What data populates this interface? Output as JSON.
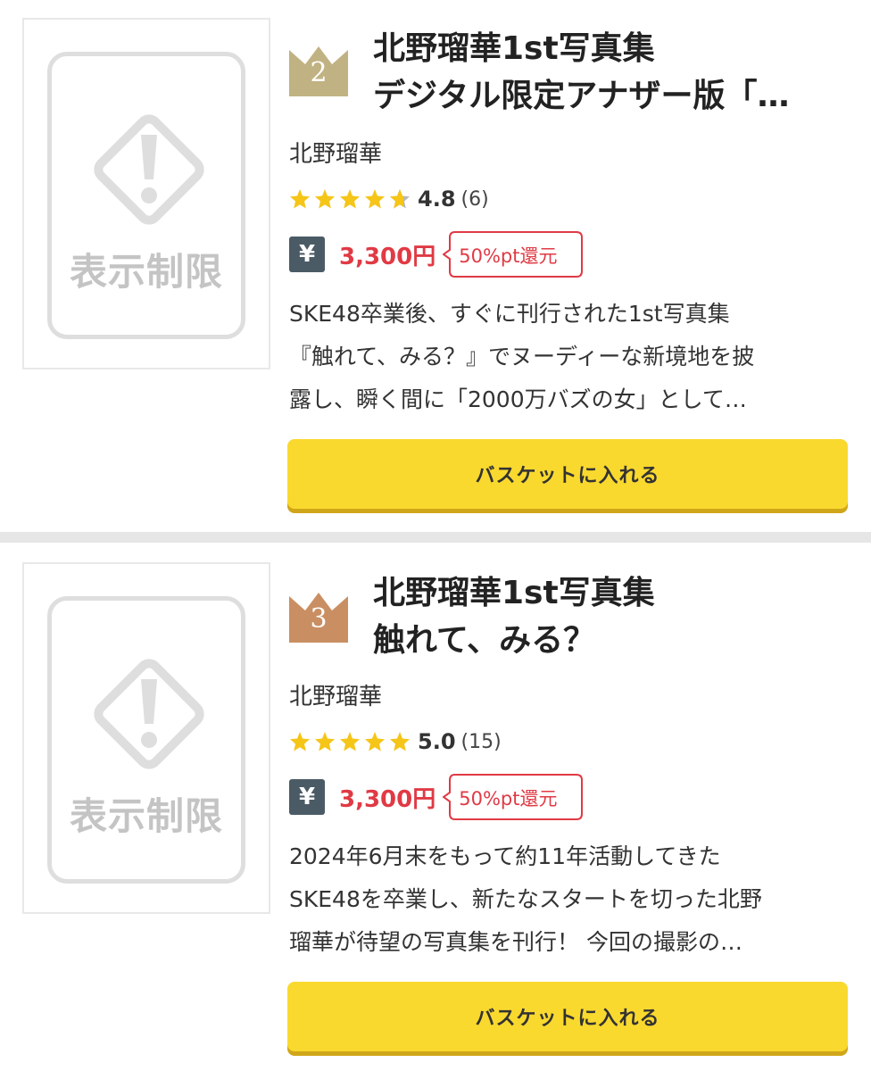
{
  "colors": {
    "accent_yellow": "#fad92e",
    "price_red": "#e03a45",
    "star": "#f5c518",
    "rank_2": "#c1b283",
    "rank_3": "#c98f63",
    "yen_badge": "#4b5b66"
  },
  "products": [
    {
      "rank": "2",
      "thumbnail_label": "表示制限",
      "title_lines": [
        "北野瑠華1st写真集",
        "デジタル限定アナザー版「…"
      ],
      "author": "北野瑠華",
      "rating_score": "4.8",
      "rating_count": "(6)",
      "stars_value": 4.8,
      "yen_icon": "¥",
      "price": "3,300円",
      "point_badge": "50%pt還元",
      "description_lines": [
        "SKE48卒業後、すぐに刊行された1st写真集",
        "『触れて、みる？』でヌーディーな新境地を披",
        "露し、瞬く間に「2000万バズの女」として…"
      ],
      "basket_label": "バスケットに入れる"
    },
    {
      "rank": "3",
      "thumbnail_label": "表示制限",
      "title_lines": [
        "北野瑠華1st写真集",
        "触れて、みる？"
      ],
      "author": "北野瑠華",
      "rating_score": "5.0",
      "rating_count": "(15)",
      "stars_value": 5.0,
      "yen_icon": "¥",
      "price": "3,300円",
      "point_badge": "50%pt還元",
      "description_lines": [
        "2024年6月末をもって約11年活動してきた",
        "SKE48を卒業し、新たなスタートを切った北野",
        "瑠華が待望の写真集を刊行！ 今回の撮影の…"
      ],
      "basket_label": "バスケットに入れる"
    }
  ]
}
